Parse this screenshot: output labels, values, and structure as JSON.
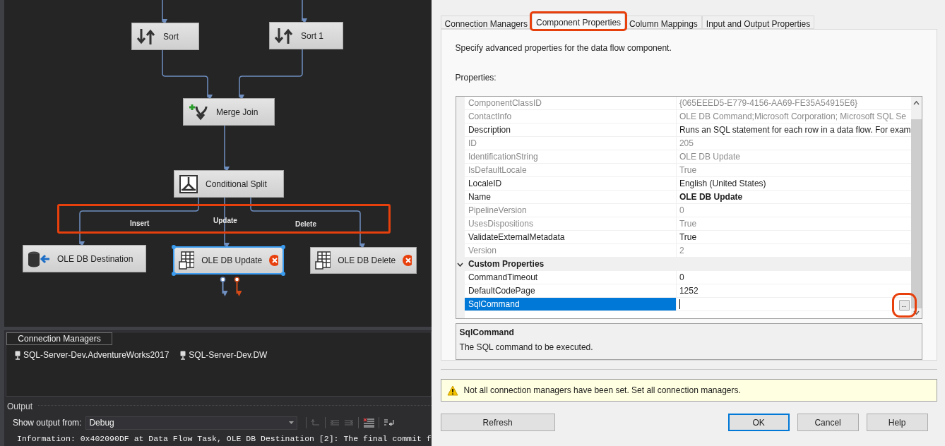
{
  "canvas": {
    "nodes": [
      {
        "label": "Sort",
        "kind": "sort",
        "selected": false,
        "error": false
      },
      {
        "label": "Sort 1",
        "kind": "sort",
        "selected": false,
        "error": false
      },
      {
        "label": "Merge Join",
        "kind": "merge",
        "selected": false,
        "error": false
      },
      {
        "label": "Conditional Split",
        "kind": "split",
        "selected": false,
        "error": false
      },
      {
        "label": "OLE DB Destination",
        "kind": "destination",
        "selected": false,
        "error": false
      },
      {
        "label": "OLE DB Update",
        "kind": "command",
        "selected": true,
        "error": true
      },
      {
        "label": "OLE DB Delete",
        "kind": "command",
        "selected": false,
        "error": true
      }
    ],
    "path_labels": [
      "Insert",
      "Update",
      "Delete"
    ],
    "paths_highlighted": true
  },
  "connection_managers": {
    "title": "Connection Managers",
    "items": [
      "SQL-Server-Dev.AdventureWorks2017",
      "SQL-Server-Dev.DW"
    ]
  },
  "output": {
    "title": "Output",
    "show_from_label": "Show output from:",
    "show_from_value": "Debug",
    "lines": [
      "Information: 0x402090DF at Data Flow Task, OLE DB Destination [2]: The final commit f"
    ]
  },
  "dialog": {
    "tabs": [
      {
        "label": "Connection Managers",
        "selected": false,
        "highlighted": false
      },
      {
        "label": "Component Properties",
        "selected": true,
        "highlighted": true
      },
      {
        "label": "Column Mappings",
        "selected": false,
        "highlighted": false
      },
      {
        "label": "Input and Output Properties",
        "selected": false,
        "highlighted": false
      }
    ],
    "description": "Specify advanced properties for the data flow component.",
    "properties_label": "Properties:",
    "properties": [
      {
        "kind": "property",
        "name": "ComponentClassID",
        "value": "{065EEED5-E779-4156-AA69-FE35A54915E6}",
        "read_only": true,
        "selected": false
      },
      {
        "kind": "property",
        "name": "ContactInfo",
        "value": "OLE DB Command;Microsoft Corporation; Microsoft SQL Se",
        "read_only": true,
        "selected": false
      },
      {
        "kind": "property",
        "name": "Description",
        "value": "Runs an SQL statement for each row in a data flow. For exam",
        "read_only": false,
        "selected": false
      },
      {
        "kind": "property",
        "name": "ID",
        "value": "205",
        "read_only": true,
        "selected": false
      },
      {
        "kind": "property",
        "name": "IdentificationString",
        "value": "OLE DB Update",
        "read_only": true,
        "selected": false
      },
      {
        "kind": "property",
        "name": "IsDefaultLocale",
        "value": "True",
        "read_only": true,
        "selected": false
      },
      {
        "kind": "property",
        "name": "LocaleID",
        "value": "English (United States)",
        "read_only": false,
        "selected": false
      },
      {
        "kind": "property",
        "name": "Name",
        "value": "OLE DB Update",
        "read_only": false,
        "modified": true,
        "selected": false
      },
      {
        "kind": "property",
        "name": "PipelineVersion",
        "value": "0",
        "read_only": true,
        "selected": false
      },
      {
        "kind": "property",
        "name": "UsesDispositions",
        "value": "True",
        "read_only": true,
        "selected": false
      },
      {
        "kind": "property",
        "name": "ValidateExternalMetadata",
        "value": "True",
        "read_only": false,
        "selected": false
      },
      {
        "kind": "property",
        "name": "Version",
        "value": "2",
        "read_only": true,
        "selected": false
      },
      {
        "kind": "category",
        "name": "Custom Properties",
        "expanded": true
      },
      {
        "kind": "property",
        "name": "CommandTimeout",
        "value": "0",
        "read_only": false,
        "selected": false
      },
      {
        "kind": "property",
        "name": "DefaultCodePage",
        "value": "1252",
        "read_only": false,
        "selected": false
      },
      {
        "kind": "property",
        "name": "SqlCommand",
        "read_only": false,
        "selected": true,
        "ellipsis": "...",
        "ellipsis_highlighted": true
      }
    ],
    "help_title": "SqlCommand",
    "help_text": "The SQL command to be executed.",
    "warning": "Not all connection managers have been set. Set all connection managers.",
    "buttons": [
      {
        "label": "Refresh",
        "default": false
      },
      {
        "label": "OK",
        "default": true
      },
      {
        "label": "Cancel",
        "default": false
      },
      {
        "label": "Help",
        "default": false
      }
    ]
  }
}
